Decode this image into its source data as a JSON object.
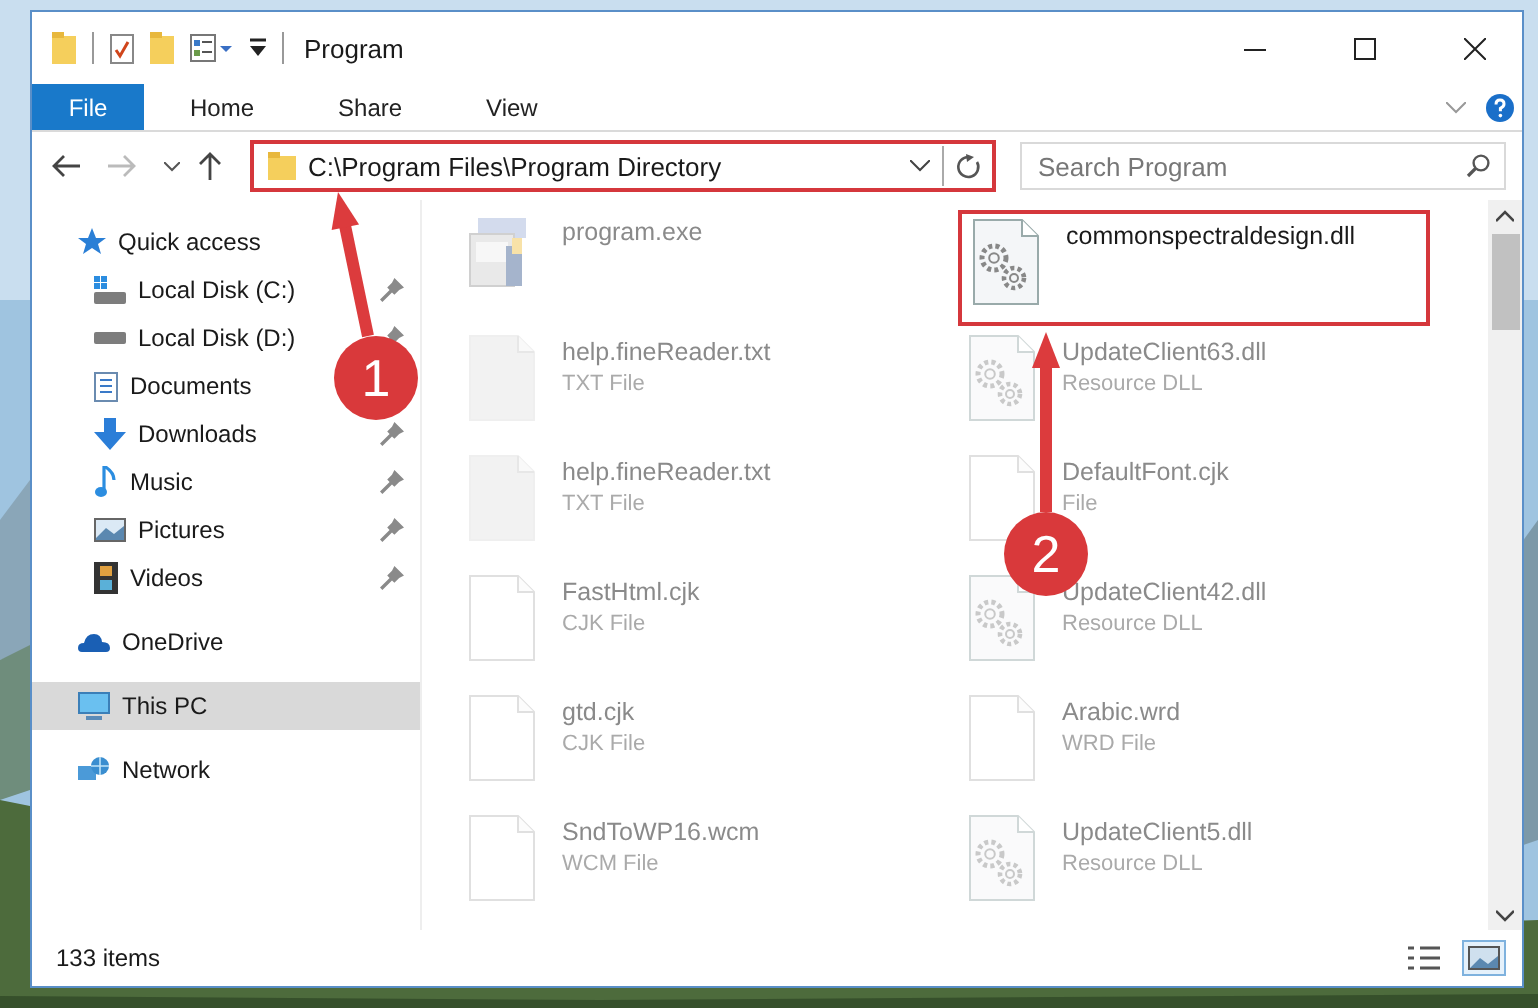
{
  "window": {
    "title": "Program"
  },
  "ribbon": {
    "tabs": [
      {
        "label": "File",
        "kind": "menu",
        "selected": false
      },
      {
        "label": "Home",
        "kind": "tab",
        "selected": false
      },
      {
        "label": "Share",
        "kind": "tab",
        "selected": false
      },
      {
        "label": "View",
        "kind": "tab",
        "selected": false
      }
    ]
  },
  "address_bar": {
    "path": "C:\\Program Files\\Program Directory",
    "highlighted": true
  },
  "search": {
    "placeholder": "Search Program"
  },
  "sidebar": {
    "items": [
      {
        "label": "Quick access",
        "kind": "star",
        "selected": false,
        "children": [
          {
            "label": "Local Disk (C:)",
            "kind": "system-drive",
            "pinned": true,
            "selected": false
          },
          {
            "label": "Local Disk (D:)",
            "kind": "drive",
            "pinned": true,
            "selected": false
          },
          {
            "label": "Documents",
            "kind": "documents",
            "selected": false
          },
          {
            "label": "Downloads",
            "kind": "downloads",
            "pinned": true,
            "selected": false
          },
          {
            "label": "Music",
            "kind": "music",
            "pinned": true,
            "selected": false
          },
          {
            "label": "Pictures",
            "kind": "pictures",
            "pinned": true,
            "selected": false
          },
          {
            "label": "Videos",
            "kind": "videos",
            "pinned": true,
            "selected": false
          }
        ]
      },
      {
        "label": "OneDrive",
        "kind": "cloud",
        "selected": false
      },
      {
        "label": "This PC",
        "kind": "pc",
        "selected": true
      },
      {
        "label": "Network",
        "kind": "network",
        "selected": false
      }
    ]
  },
  "files": [
    {
      "name": "program.exe",
      "kind": "exe",
      "faded": true,
      "highlighted": false
    },
    {
      "name": "commonspectraldesign.dll",
      "kind": "dll",
      "faded": false,
      "highlighted": true
    },
    {
      "name": "help.fineReader.txt",
      "type": "TXT File",
      "kind": "txt",
      "faded": true,
      "highlighted": false
    },
    {
      "name": "UpdateClient63.dll",
      "type": "Resource DLL",
      "kind": "dll",
      "faded": true,
      "highlighted": false
    },
    {
      "name": "help.fineReader.txt",
      "type": "TXT File",
      "kind": "txt",
      "faded": true,
      "highlighted": false
    },
    {
      "name": "DefaultFont.cjk",
      "type": "File",
      "kind": "file",
      "faded": true,
      "highlighted": false
    },
    {
      "name": "FastHtml.cjk",
      "type": "CJK File",
      "kind": "file",
      "faded": true,
      "highlighted": false
    },
    {
      "name": "UpdateClient42.dll",
      "type": "Resource DLL",
      "kind": "dll",
      "faded": true,
      "highlighted": false
    },
    {
      "name": "gtd.cjk",
      "type": "CJK File",
      "kind": "file",
      "faded": true,
      "highlighted": false
    },
    {
      "name": "Arabic.wrd",
      "type": "WRD File",
      "kind": "file",
      "faded": true,
      "highlighted": false
    },
    {
      "name": "SndToWP16.wcm",
      "type": "WCM File",
      "kind": "file",
      "faded": true,
      "highlighted": false
    },
    {
      "name": "UpdateClient5.dll",
      "type": "Resource DLL",
      "kind": "dll",
      "faded": true,
      "highlighted": false
    }
  ],
  "status_bar": {
    "count": "133 items",
    "views": [
      {
        "kind": "details",
        "selected": false
      },
      {
        "kind": "large-icons",
        "selected": true
      }
    ]
  },
  "callouts": [
    {
      "number": "1"
    },
    {
      "number": "2"
    }
  ]
}
